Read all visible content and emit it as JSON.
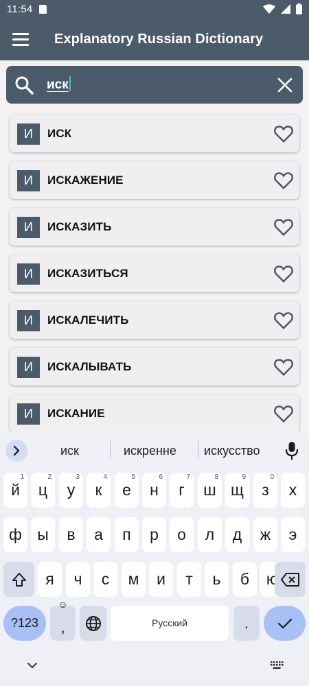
{
  "status_bar": {
    "time": "11:54"
  },
  "app_bar": {
    "title": "Explanatory Russian Dictionary"
  },
  "search": {
    "query": "иск"
  },
  "results": [
    {
      "letter": "И",
      "word": "ИСК"
    },
    {
      "letter": "И",
      "word": "ИСКАЖЕНИЕ"
    },
    {
      "letter": "И",
      "word": "ИСКАЗИТЬ"
    },
    {
      "letter": "И",
      "word": "ИСКАЗИТЬСЯ"
    },
    {
      "letter": "И",
      "word": "ИСКАЛЕЧИТЬ"
    },
    {
      "letter": "И",
      "word": "ИСКАЛЫВАТЬ"
    },
    {
      "letter": "И",
      "word": "ИСКАНИЕ"
    }
  ],
  "keyboard": {
    "suggestions": [
      "иск",
      "искренне",
      "искусство"
    ],
    "row1": [
      {
        "k": "й",
        "h": "1"
      },
      {
        "k": "ц",
        "h": "2"
      },
      {
        "k": "у",
        "h": "3"
      },
      {
        "k": "к",
        "h": "4"
      },
      {
        "k": "е",
        "h": "5"
      },
      {
        "k": "н",
        "h": "6"
      },
      {
        "k": "г",
        "h": "7"
      },
      {
        "k": "ш",
        "h": "8"
      },
      {
        "k": "щ",
        "h": "9"
      },
      {
        "k": "з",
        "h": "0"
      },
      {
        "k": "х",
        "h": ""
      }
    ],
    "row2": [
      "ф",
      "ы",
      "в",
      "а",
      "п",
      "р",
      "о",
      "л",
      "д",
      "ж",
      "э"
    ],
    "row3": [
      "я",
      "ч",
      "с",
      "м",
      "и",
      "т",
      "ь",
      "б",
      "ю"
    ],
    "symbols_label": "?123",
    "emoji_comma": ",",
    "space_label": "Русский",
    "period": "."
  },
  "colors": {
    "primary": "#4b5b69",
    "accent": "#a9c0f4",
    "background": "#f3f1f3"
  }
}
